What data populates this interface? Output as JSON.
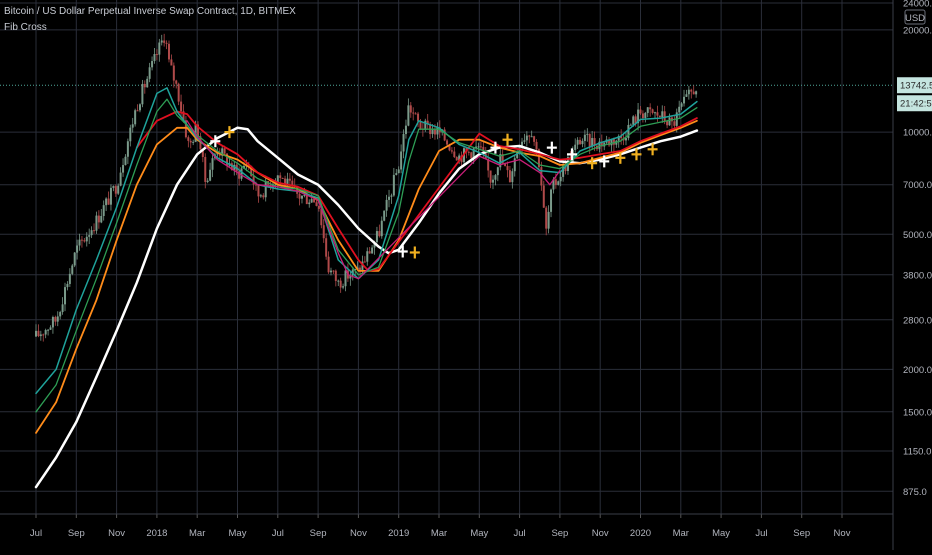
{
  "header": {
    "title": "Bitcoin / US Dollar Perpetual Inverse Swap Contract, 1D, BITMEX",
    "indicator": "Fib Cross"
  },
  "price_axis": {
    "currency_badge": "USD",
    "last_price": "13742.5",
    "countdown": "21:42:50"
  },
  "colors": {
    "background": "#000000",
    "grid": "#2a2e39",
    "candle_up": "#7a9a8a",
    "candle_down": "#b04a4a",
    "ma_white": "#ffffff",
    "ma_orange": "#ff8c1a",
    "ma_red": "#e01020",
    "ma_teal": "#1fa39b",
    "ma_green": "#2e9e55",
    "ma_magenta": "#c81e78",
    "cross_white": "#ffffff",
    "cross_gold": "#f0b020",
    "badge_bg": "#c5e5e0"
  },
  "chart_data": {
    "type": "line",
    "title": "Bitcoin / US Dollar Perpetual Inverse Swap Contract, 1D, BITMEX",
    "indicator": "Fib Cross",
    "y_scale": "log",
    "ylim": [
      750,
      24500
    ],
    "grid": true,
    "y_ticks": [
      {
        "value": 24000,
        "label": "24000.0"
      },
      {
        "value": 20000,
        "label": "20000.0"
      },
      {
        "value": 10000,
        "label": "10000.0"
      },
      {
        "value": 7000,
        "label": "7000.0"
      },
      {
        "value": 5000,
        "label": "5000.0"
      },
      {
        "value": 3800,
        "label": "3800.0"
      },
      {
        "value": 2800,
        "label": "2800.0"
      },
      {
        "value": 2000,
        "label": "2000.0"
      },
      {
        "value": 1500,
        "label": "1500.0"
      },
      {
        "value": 1150,
        "label": "1150.0"
      },
      {
        "value": 875,
        "label": "875.0"
      }
    ],
    "x_ticks": [
      "Jul",
      "Sep",
      "Nov",
      "2018",
      "Mar",
      "May",
      "Jul",
      "Sep",
      "Nov",
      "2019",
      "Mar",
      "May",
      "Jul",
      "Sep",
      "Nov",
      "2020",
      "Mar",
      "May",
      "Jul",
      "Sep",
      "Nov"
    ],
    "x_range_months": [
      0,
      41
    ],
    "price_path": [
      [
        0,
        2500
      ],
      [
        1,
        2800
      ],
      [
        2,
        4500
      ],
      [
        3,
        5500
      ],
      [
        4,
        7000
      ],
      [
        5,
        12000
      ],
      [
        6,
        17000
      ],
      [
        6.4,
        19500
      ],
      [
        6.6,
        16000
      ],
      [
        7,
        13500
      ],
      [
        7.6,
        9000
      ],
      [
        8,
        10500
      ],
      [
        8.4,
        7200
      ],
      [
        9,
        9000
      ],
      [
        10,
        7500
      ],
      [
        10.5,
        8200
      ],
      [
        11,
        6500
      ],
      [
        12,
        7500
      ],
      [
        13,
        6500
      ],
      [
        13.5,
        6400
      ],
      [
        14,
        6300
      ],
      [
        14.5,
        4000
      ],
      [
        15,
        3600
      ],
      [
        15.5,
        3800
      ],
      [
        16,
        3900
      ],
      [
        17,
        5000
      ],
      [
        18,
        8000
      ],
      [
        18.5,
        12000
      ],
      [
        19,
        10500
      ],
      [
        20,
        10000
      ],
      [
        21,
        8500
      ],
      [
        22,
        9000
      ],
      [
        22.6,
        7200
      ],
      [
        23,
        8500
      ],
      [
        23.5,
        7300
      ],
      [
        24,
        9500
      ],
      [
        24.6,
        10200
      ],
      [
        25,
        8000
      ],
      [
        25.3,
        5000
      ],
      [
        25.6,
        6800
      ],
      [
        26,
        7500
      ],
      [
        27,
        9500
      ],
      [
        28,
        9300
      ],
      [
        29,
        9600
      ],
      [
        30,
        11500
      ],
      [
        31,
        11200
      ],
      [
        31.6,
        10500
      ],
      [
        32,
        11800
      ],
      [
        32.5,
        13000
      ],
      [
        32.8,
        13742.5
      ]
    ],
    "series": [
      {
        "name": "",
        "color": "#ffffff",
        "width": 2.5,
        "values": [
          [
            0,
            900
          ],
          [
            1,
            1100
          ],
          [
            2,
            1400
          ],
          [
            3,
            1900
          ],
          [
            4,
            2600
          ],
          [
            5,
            3600
          ],
          [
            6,
            5200
          ],
          [
            7,
            7000
          ],
          [
            8,
            8600
          ],
          [
            9,
            9600
          ],
          [
            10,
            10300
          ],
          [
            10.5,
            10200
          ],
          [
            11,
            9400
          ],
          [
            12,
            8400
          ],
          [
            13,
            7500
          ],
          [
            14,
            7000
          ],
          [
            15,
            6100
          ],
          [
            16,
            5200
          ],
          [
            17,
            4600
          ],
          [
            17.5,
            4400
          ],
          [
            18,
            4500
          ],
          [
            19,
            5400
          ],
          [
            20,
            6600
          ],
          [
            21,
            7800
          ],
          [
            22,
            8600
          ],
          [
            23,
            9000
          ],
          [
            24,
            9100
          ],
          [
            25,
            8700
          ],
          [
            26,
            8200
          ],
          [
            27,
            8100
          ],
          [
            28,
            8300
          ],
          [
            29,
            8600
          ],
          [
            30,
            9000
          ],
          [
            31,
            9400
          ],
          [
            32,
            9700
          ],
          [
            32.8,
            10100
          ]
        ]
      },
      {
        "name": "",
        "color": "#ff8c1a",
        "width": 1.8,
        "values": [
          [
            0,
            1300
          ],
          [
            1,
            1600
          ],
          [
            2,
            2300
          ],
          [
            3,
            3200
          ],
          [
            4,
            4800
          ],
          [
            5,
            7000
          ],
          [
            6,
            9200
          ],
          [
            7,
            10300
          ],
          [
            7.5,
            10300
          ],
          [
            8,
            9500
          ],
          [
            9,
            8700
          ],
          [
            10,
            8300
          ],
          [
            11,
            7600
          ],
          [
            12,
            7000
          ],
          [
            13,
            6800
          ],
          [
            14,
            6300
          ],
          [
            15,
            4800
          ],
          [
            16,
            3900
          ],
          [
            17,
            3900
          ],
          [
            18,
            4800
          ],
          [
            19,
            6800
          ],
          [
            20,
            8800
          ],
          [
            21,
            9500
          ],
          [
            22,
            9500
          ],
          [
            23,
            9000
          ],
          [
            24,
            8700
          ],
          [
            25,
            8500
          ],
          [
            26,
            8000
          ],
          [
            27,
            8100
          ],
          [
            28,
            8400
          ],
          [
            29,
            8700
          ],
          [
            30,
            9300
          ],
          [
            31,
            9800
          ],
          [
            32,
            10300
          ],
          [
            32.8,
            10800
          ]
        ]
      },
      {
        "name": "",
        "color": "#e01020",
        "width": 1.8,
        "values": [
          [
            5,
            9000
          ],
          [
            6,
            10800
          ],
          [
            7,
            11500
          ],
          [
            7.5,
            11300
          ],
          [
            8,
            10400
          ],
          [
            9,
            9300
          ],
          [
            10,
            8600
          ],
          [
            11,
            7600
          ],
          [
            12,
            7100
          ],
          [
            13,
            6900
          ],
          [
            14,
            6500
          ],
          [
            15,
            5200
          ],
          [
            16,
            4200
          ],
          [
            16.5,
            3900
          ],
          [
            17,
            3950
          ],
          [
            22,
            9900
          ],
          [
            23,
            9100
          ],
          [
            24,
            8900
          ],
          [
            25,
            8600
          ],
          [
            26,
            8300
          ],
          [
            27,
            8400
          ],
          [
            28,
            8600
          ],
          [
            29,
            8800
          ],
          [
            30,
            9400
          ],
          [
            31,
            9900
          ],
          [
            32,
            10400
          ],
          [
            32.8,
            11000
          ]
        ]
      },
      {
        "name": "",
        "color": "#1fa39b",
        "width": 1.5,
        "values": [
          [
            0,
            1700
          ],
          [
            1,
            2000
          ],
          [
            2,
            3000
          ],
          [
            3,
            4200
          ],
          [
            4,
            6000
          ],
          [
            5,
            9000
          ],
          [
            6,
            13000
          ],
          [
            6.5,
            13500
          ],
          [
            7,
            11500
          ],
          [
            8,
            9600
          ],
          [
            9,
            8400
          ],
          [
            10,
            7800
          ],
          [
            11,
            7000
          ],
          [
            12,
            6800
          ],
          [
            13,
            6700
          ],
          [
            14,
            6400
          ],
          [
            15,
            4200
          ],
          [
            16,
            3700
          ],
          [
            17,
            4200
          ],
          [
            18,
            6500
          ],
          [
            18.5,
            9500
          ],
          [
            19,
            10800
          ],
          [
            20,
            10300
          ],
          [
            21,
            9200
          ],
          [
            22,
            8700
          ],
          [
            23,
            8100
          ],
          [
            24,
            8700
          ],
          [
            25,
            7700
          ],
          [
            26,
            7600
          ],
          [
            27,
            8800
          ],
          [
            28,
            9300
          ],
          [
            29,
            9700
          ],
          [
            30,
            10900
          ],
          [
            31,
            11000
          ],
          [
            32,
            11300
          ],
          [
            32.8,
            12300
          ]
        ]
      },
      {
        "name": "",
        "color": "#2e9e55",
        "width": 1.3,
        "values": [
          [
            0,
            1500
          ],
          [
            1,
            1800
          ],
          [
            2,
            2600
          ],
          [
            3,
            3700
          ],
          [
            4,
            5400
          ],
          [
            5,
            8000
          ],
          [
            6,
            11500
          ],
          [
            6.5,
            12500
          ],
          [
            7,
            11200
          ],
          [
            8,
            9800
          ],
          [
            9,
            8800
          ],
          [
            10,
            8100
          ],
          [
            11,
            7300
          ],
          [
            12,
            6900
          ],
          [
            13,
            6800
          ],
          [
            14,
            6500
          ],
          [
            15,
            4500
          ],
          [
            16,
            3800
          ],
          [
            17,
            4000
          ],
          [
            18,
            5800
          ],
          [
            18.5,
            8200
          ],
          [
            19,
            10200
          ],
          [
            20,
            10200
          ],
          [
            21,
            9300
          ],
          [
            22,
            8900
          ],
          [
            23,
            8500
          ],
          [
            24,
            8800
          ],
          [
            25,
            8000
          ],
          [
            26,
            7800
          ],
          [
            27,
            8600
          ],
          [
            28,
            9100
          ],
          [
            29,
            9400
          ],
          [
            30,
            10400
          ],
          [
            31,
            10700
          ],
          [
            32,
            11000
          ],
          [
            32.8,
            11800
          ]
        ]
      },
      {
        "name": "",
        "color": "#c81e78",
        "width": 1.3,
        "values": [
          [
            7.5,
            10800
          ],
          [
            8,
            9700
          ],
          [
            9,
            8300
          ],
          [
            10,
            7600
          ],
          [
            11,
            7000
          ],
          [
            12,
            6900
          ],
          [
            13,
            6700
          ],
          [
            14,
            6300
          ],
          [
            15,
            4400
          ],
          [
            15.5,
            3800
          ],
          [
            16,
            3700
          ],
          [
            22,
            8500
          ],
          [
            23,
            8000
          ],
          [
            24,
            8300
          ],
          [
            25,
            7600
          ],
          [
            25.5,
            7000
          ],
          [
            26,
            7700
          ]
        ]
      }
    ],
    "crosses": [
      {
        "x": 8.9,
        "y": 9400,
        "color": "#ffffff"
      },
      {
        "x": 9.6,
        "y": 10000,
        "color": "#f0b020"
      },
      {
        "x": 18.2,
        "y": 4450,
        "color": "#ffffff"
      },
      {
        "x": 18.8,
        "y": 4420,
        "color": "#f0b020"
      },
      {
        "x": 22.8,
        "y": 9000,
        "color": "#ffffff"
      },
      {
        "x": 23.4,
        "y": 9500,
        "color": "#f0b020"
      },
      {
        "x": 25.6,
        "y": 9000,
        "color": "#ffffff"
      },
      {
        "x": 26.6,
        "y": 8600,
        "color": "#ffffff"
      },
      {
        "x": 27.6,
        "y": 8100,
        "color": "#f0b020"
      },
      {
        "x": 28.2,
        "y": 8200,
        "color": "#ffffff"
      },
      {
        "x": 29.0,
        "y": 8400,
        "color": "#f0b020"
      },
      {
        "x": 29.8,
        "y": 8600,
        "color": "#f0b020"
      },
      {
        "x": 30.6,
        "y": 8900,
        "color": "#f0b020"
      }
    ]
  }
}
